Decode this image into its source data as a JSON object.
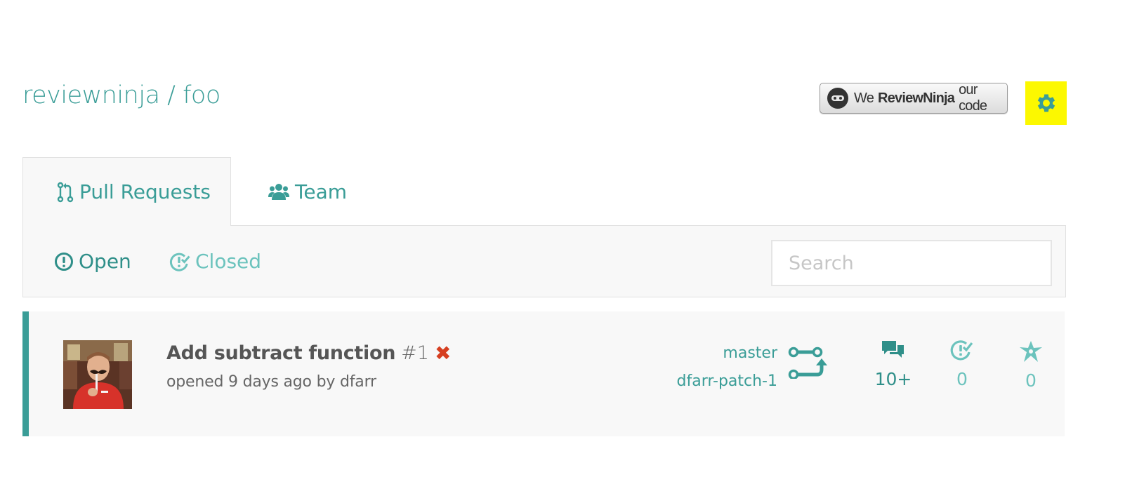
{
  "colors": {
    "accent": "#3a9d97",
    "accent_light": "#6cc3bd",
    "highlight": "#fcf800",
    "status_failed": "#d63f21"
  },
  "repo": {
    "owner": "reviewninja",
    "separator": "/",
    "name": "foo"
  },
  "badge": {
    "word1": "We",
    "word2": "ReviewNinja",
    "word3": "our code"
  },
  "settings": {
    "icon": "gear-icon"
  },
  "tabs": [
    {
      "label": "Pull Requests",
      "icon": "pull-request-icon",
      "active": true
    },
    {
      "label": "Team",
      "icon": "users-icon",
      "active": false
    }
  ],
  "filters": {
    "open_label": "Open",
    "closed_label": "Closed",
    "search_placeholder": "Search"
  },
  "pull_requests": [
    {
      "title": "Add subtract function",
      "number": "#1",
      "status_symbol": "✖",
      "meta": "opened 9 days ago by dfarr",
      "base_branch": "master",
      "head_branch": "dfarr-patch-1",
      "comments": "10+",
      "reviews": "0",
      "stars": "0"
    }
  ]
}
